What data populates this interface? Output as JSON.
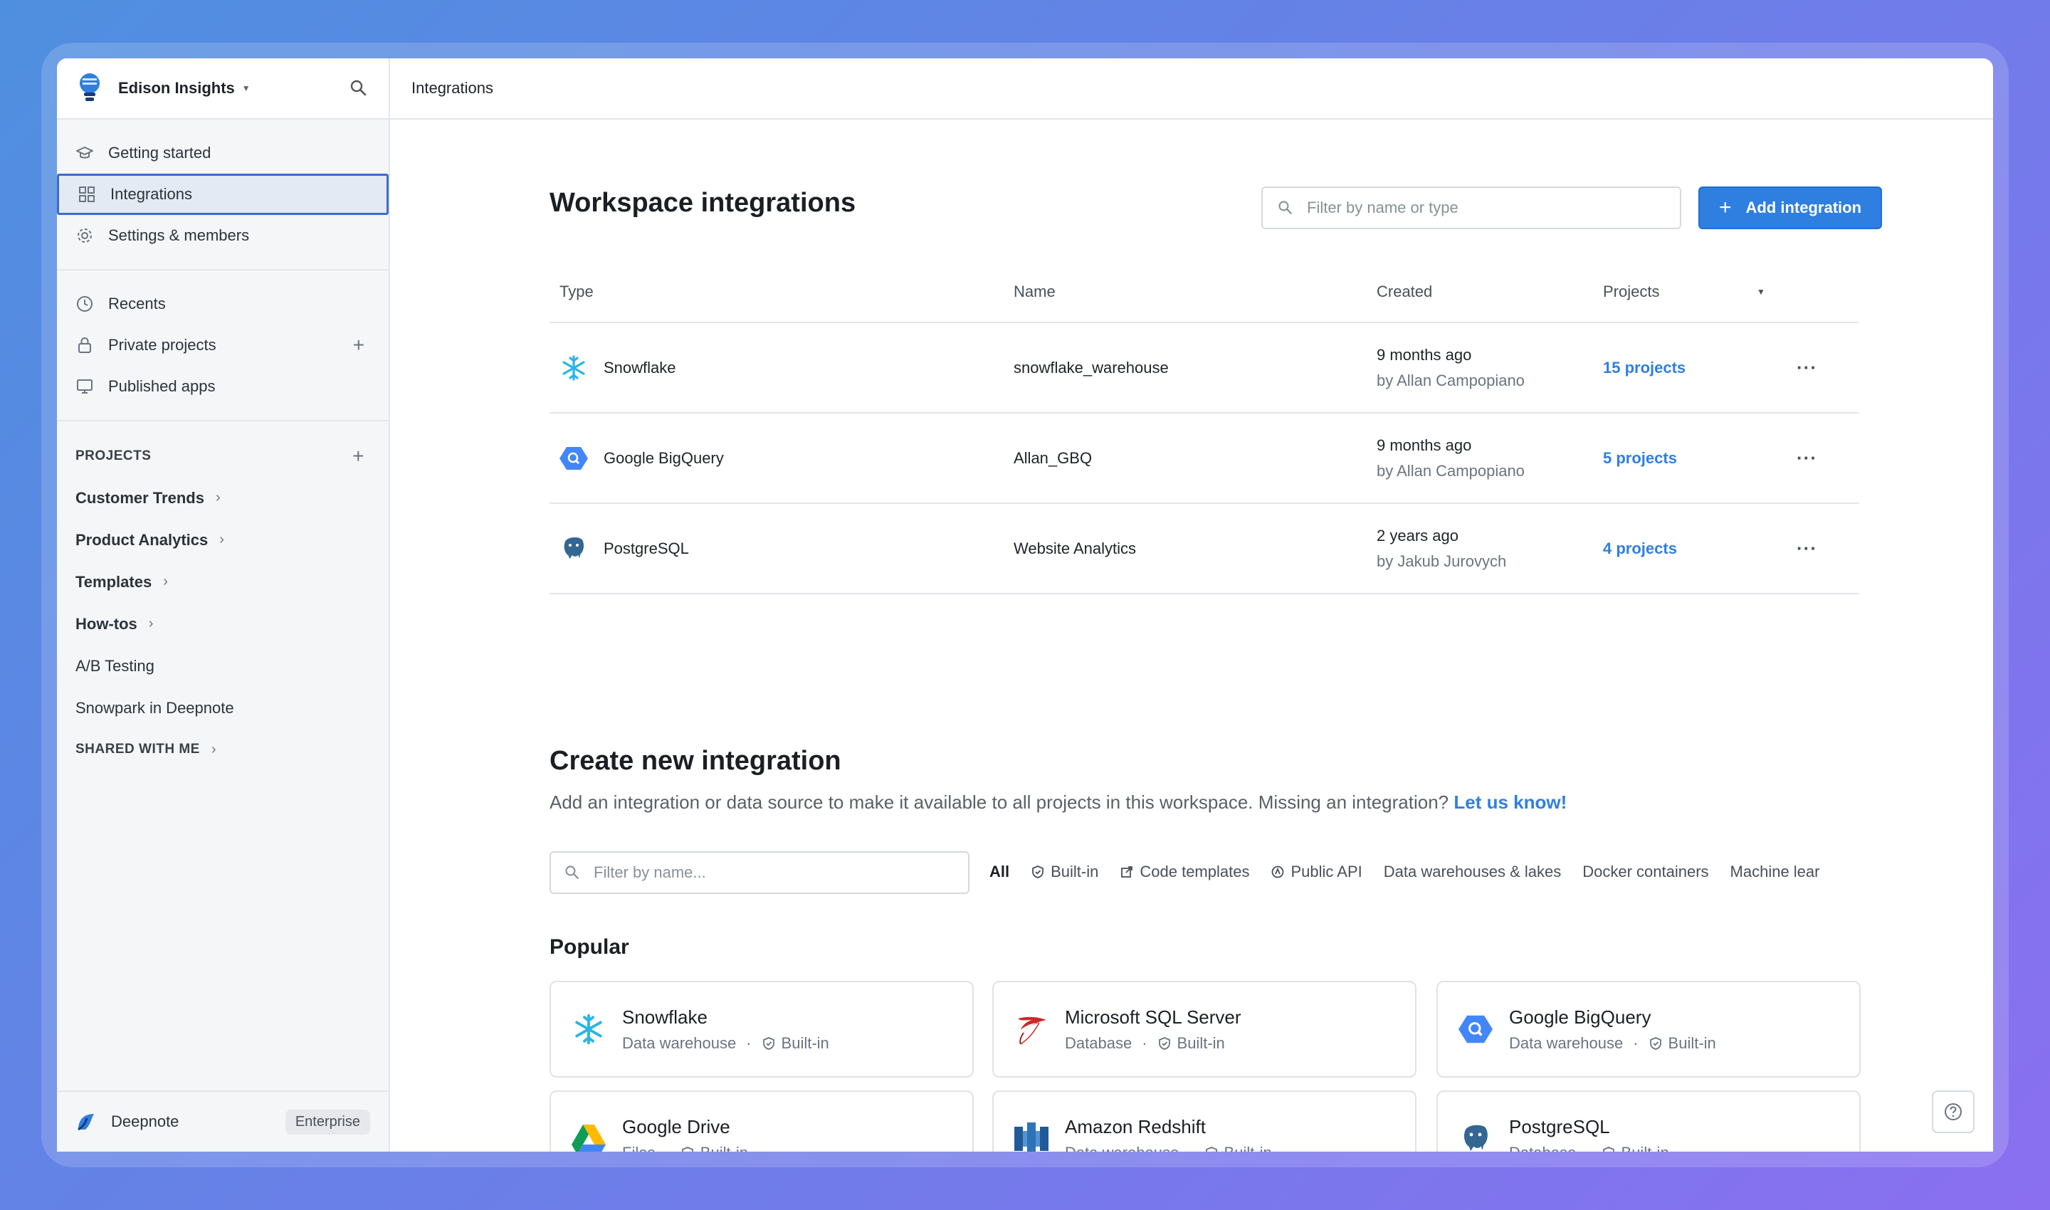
{
  "workspace": {
    "name": "Edison Insights"
  },
  "topbar": {
    "title": "Integrations"
  },
  "sidebar": {
    "main_items": [
      {
        "label": "Getting started",
        "icon": "graduation-cap-icon"
      },
      {
        "label": "Integrations",
        "icon": "grid-icon",
        "active": true
      },
      {
        "label": "Settings & members",
        "icon": "gear-icon"
      }
    ],
    "secondary_items": [
      {
        "label": "Recents",
        "icon": "clock-icon"
      },
      {
        "label": "Private projects",
        "icon": "lock-icon"
      },
      {
        "label": "Published apps",
        "icon": "monitor-icon"
      }
    ],
    "projects_heading": "PROJECTS",
    "projects": [
      {
        "label": "Customer Trends",
        "bold": true,
        "expandable": true
      },
      {
        "label": "Product Analytics",
        "bold": true,
        "expandable": true
      },
      {
        "label": "Templates",
        "bold": true,
        "expandable": true
      },
      {
        "label": "How-tos",
        "bold": true,
        "expandable": true
      },
      {
        "label": "A/B Testing",
        "bold": false,
        "expandable": false
      },
      {
        "label": "Snowpark in Deepnote",
        "bold": false,
        "expandable": false
      }
    ],
    "shared_heading": "SHARED WITH ME",
    "footer": {
      "name": "Deepnote",
      "badge": "Enterprise"
    }
  },
  "workspace_integrations": {
    "title": "Workspace integrations",
    "filter_placeholder": "Filter by name or type",
    "add_button": "Add integration",
    "columns": {
      "type": "Type",
      "name": "Name",
      "created": "Created",
      "projects": "Projects"
    },
    "rows": [
      {
        "type": "Snowflake",
        "icon": "snowflake-icon",
        "name": "snowflake_warehouse",
        "created": "9 months ago",
        "by": "by Allan Campopiano",
        "projects": "15 projects"
      },
      {
        "type": "Google BigQuery",
        "icon": "bigquery-icon",
        "name": "Allan_GBQ",
        "created": "9 months ago",
        "by": "by Allan Campopiano",
        "projects": "5 projects"
      },
      {
        "type": "PostgreSQL",
        "icon": "postgresql-icon",
        "name": "Website Analytics",
        "created": "2 years ago",
        "by": "by Jakub Jurovych",
        "projects": "4 projects"
      }
    ],
    "more_label": "···"
  },
  "create": {
    "title": "Create new integration",
    "description": "Add an integration or data source to make it available to all projects in this workspace. Missing an integration?",
    "link": "Let us know!",
    "filter_placeholder": "Filter by name...",
    "categories": [
      "All",
      "Built-in",
      "Code templates",
      "Public API",
      "Data warehouses & lakes",
      "Docker containers",
      "Machine lear"
    ],
    "popular_heading": "Popular",
    "cards": [
      {
        "title": "Snowflake",
        "kind": "Data warehouse",
        "tag": "Built-in",
        "icon": "snowflake-icon"
      },
      {
        "title": "Microsoft SQL Server",
        "kind": "Database",
        "tag": "Built-in",
        "icon": "sql-server-icon"
      },
      {
        "title": "Google BigQuery",
        "kind": "Data warehouse",
        "tag": "Built-in",
        "icon": "bigquery-icon"
      },
      {
        "title": "Google Drive",
        "kind": "Files",
        "tag": "Built-in",
        "icon": "google-drive-icon"
      },
      {
        "title": "Amazon Redshift",
        "kind": "Data warehouse",
        "tag": "Built-in",
        "icon": "redshift-icon"
      },
      {
        "title": "PostgreSQL",
        "kind": "Database",
        "tag": "Built-in",
        "icon": "postgresql-icon"
      }
    ],
    "dot": "·"
  }
}
